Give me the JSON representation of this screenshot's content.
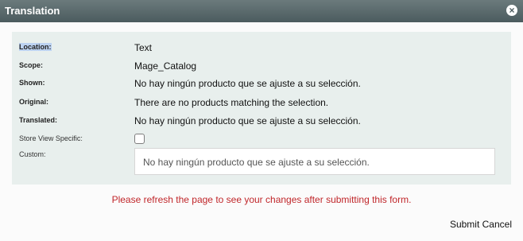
{
  "dialog": {
    "title": "Translation",
    "close_icon": "close-icon"
  },
  "form": {
    "location": {
      "label": "Location:",
      "value": "Text"
    },
    "scope": {
      "label": "Scope:",
      "value": "Mage_Catalog"
    },
    "shown": {
      "label": "Shown:",
      "value": "No hay ningún producto que se ajuste a su selección."
    },
    "original": {
      "label": "Original:",
      "value": "There are no products matching the selection."
    },
    "translated": {
      "label": "Translated:",
      "value": "No hay ningún producto que se ajuste a su selección."
    },
    "store_view_specific": {
      "label": "Store View Specific:",
      "checked": false
    },
    "custom": {
      "label": "Custom:",
      "value": "No hay ningún producto que se ajuste a su selección."
    }
  },
  "notice": "Please refresh the page to see your changes after submitting this form.",
  "actions": {
    "submit_label": "Submit",
    "cancel_label": "Cancel"
  },
  "colors": {
    "titlebar": "#5a6a6c",
    "panel": "#e8efed",
    "notice": "#c0262a"
  }
}
